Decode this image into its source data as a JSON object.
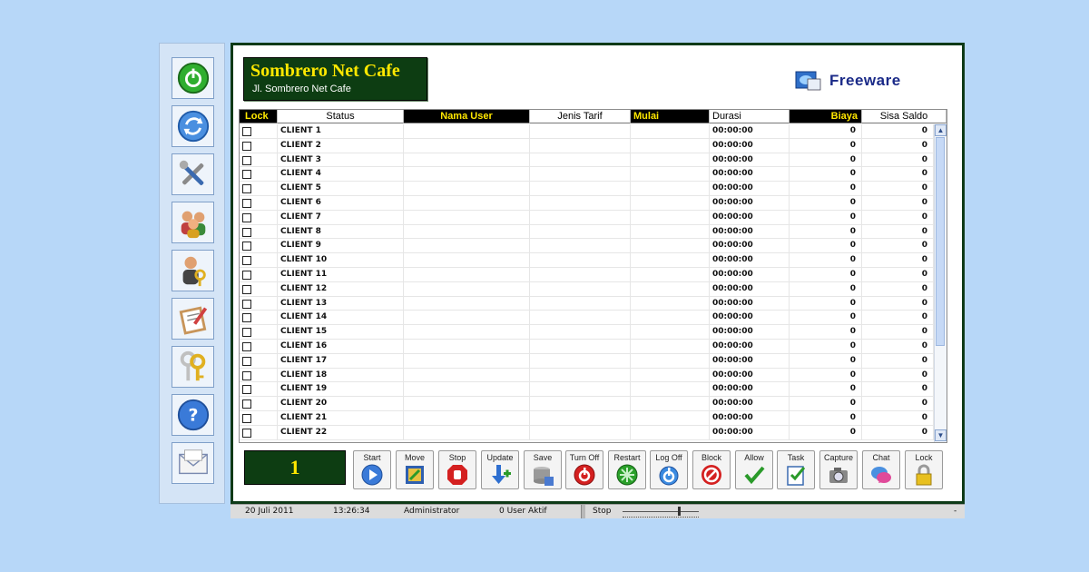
{
  "sidebar": {
    "items": [
      {
        "name": "power-icon"
      },
      {
        "name": "refresh-icon"
      },
      {
        "name": "tools-icon"
      },
      {
        "name": "users-icon"
      },
      {
        "name": "admin-key-icon"
      },
      {
        "name": "notes-icon"
      },
      {
        "name": "keys-icon"
      },
      {
        "name": "help-icon"
      },
      {
        "name": "mail-icon"
      }
    ]
  },
  "header": {
    "brand_title": "Sombrero Net Cafe",
    "brand_subtitle": "Jl. Sombrero Net Cafe",
    "freeware_label": "Freeware"
  },
  "table": {
    "columns": [
      "Lock",
      "Status",
      "Nama User",
      "Jenis Tarif",
      "Mulai",
      "Durasi",
      "Biaya",
      "Sisa Saldo"
    ],
    "rows": [
      {
        "status": "CLIENT 1",
        "durasi": "00:00:00",
        "biaya": "0",
        "sisa": "0"
      },
      {
        "status": "CLIENT 2",
        "durasi": "00:00:00",
        "biaya": "0",
        "sisa": "0"
      },
      {
        "status": "CLIENT 3",
        "durasi": "00:00:00",
        "biaya": "0",
        "sisa": "0"
      },
      {
        "status": "CLIENT 4",
        "durasi": "00:00:00",
        "biaya": "0",
        "sisa": "0"
      },
      {
        "status": "CLIENT 5",
        "durasi": "00:00:00",
        "biaya": "0",
        "sisa": "0"
      },
      {
        "status": "CLIENT 6",
        "durasi": "00:00:00",
        "biaya": "0",
        "sisa": "0"
      },
      {
        "status": "CLIENT 7",
        "durasi": "00:00:00",
        "biaya": "0",
        "sisa": "0"
      },
      {
        "status": "CLIENT 8",
        "durasi": "00:00:00",
        "biaya": "0",
        "sisa": "0"
      },
      {
        "status": "CLIENT 9",
        "durasi": "00:00:00",
        "biaya": "0",
        "sisa": "0"
      },
      {
        "status": "CLIENT 10",
        "durasi": "00:00:00",
        "biaya": "0",
        "sisa": "0"
      },
      {
        "status": "CLIENT 11",
        "durasi": "00:00:00",
        "biaya": "0",
        "sisa": "0"
      },
      {
        "status": "CLIENT 12",
        "durasi": "00:00:00",
        "biaya": "0",
        "sisa": "0"
      },
      {
        "status": "CLIENT 13",
        "durasi": "00:00:00",
        "biaya": "0",
        "sisa": "0"
      },
      {
        "status": "CLIENT 14",
        "durasi": "00:00:00",
        "biaya": "0",
        "sisa": "0"
      },
      {
        "status": "CLIENT 15",
        "durasi": "00:00:00",
        "biaya": "0",
        "sisa": "0"
      },
      {
        "status": "CLIENT 16",
        "durasi": "00:00:00",
        "biaya": "0",
        "sisa": "0"
      },
      {
        "status": "CLIENT 17",
        "durasi": "00:00:00",
        "biaya": "0",
        "sisa": "0"
      },
      {
        "status": "CLIENT 18",
        "durasi": "00:00:00",
        "biaya": "0",
        "sisa": "0"
      },
      {
        "status": "CLIENT 19",
        "durasi": "00:00:00",
        "biaya": "0",
        "sisa": "0"
      },
      {
        "status": "CLIENT 20",
        "durasi": "00:00:00",
        "biaya": "0",
        "sisa": "0"
      },
      {
        "status": "CLIENT 21",
        "durasi": "00:00:00",
        "biaya": "0",
        "sisa": "0"
      },
      {
        "status": "CLIENT 22",
        "durasi": "00:00:00",
        "biaya": "0",
        "sisa": "0"
      }
    ]
  },
  "counter": {
    "value": "1"
  },
  "toolbar": {
    "buttons": [
      {
        "label": "Start",
        "icon": "play-icon"
      },
      {
        "label": "Move",
        "icon": "move-icon"
      },
      {
        "label": "Stop",
        "icon": "stop-hand-icon"
      },
      {
        "label": "Update",
        "icon": "update-icon"
      },
      {
        "label": "Save",
        "icon": "save-icon"
      },
      {
        "label": "Turn Off",
        "icon": "turn-off-icon"
      },
      {
        "label": "Restart",
        "icon": "restart-icon"
      },
      {
        "label": "Log Off",
        "icon": "log-off-icon"
      },
      {
        "label": "Block",
        "icon": "block-icon"
      },
      {
        "label": "Allow",
        "icon": "allow-check-icon"
      },
      {
        "label": "Task",
        "icon": "task-icon"
      },
      {
        "label": "Capture",
        "icon": "camera-icon"
      },
      {
        "label": "Chat",
        "icon": "chat-icon"
      },
      {
        "label": "Lock",
        "icon": "lock-icon"
      }
    ]
  },
  "statusbar": {
    "date": "20 Juli 2011",
    "time": "13:26:34",
    "user": "Administrator",
    "active_users": "0 User Aktif",
    "slider_label": "Stop",
    "end_mark": "-"
  },
  "colors": {
    "background": "#b7d7f8",
    "brand_green": "#0d3d12",
    "brand_yellow": "#ffe800"
  }
}
